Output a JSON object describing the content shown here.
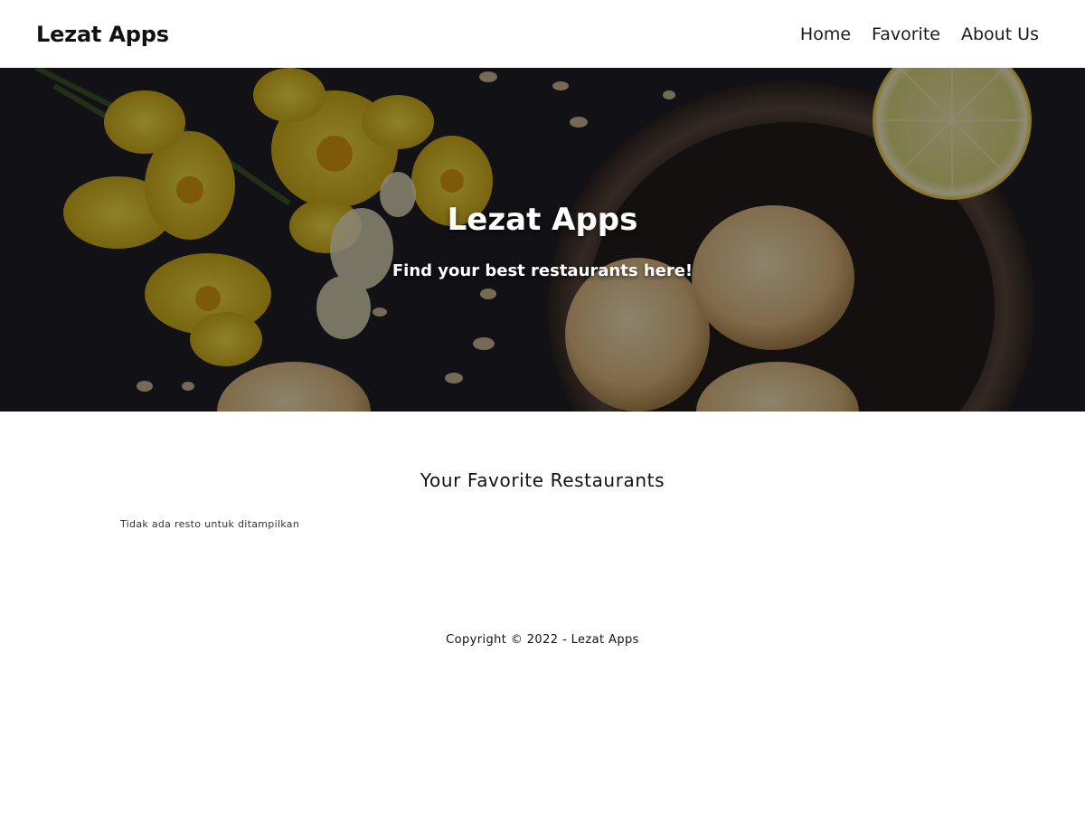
{
  "header": {
    "brand": "Lezat Apps",
    "nav": {
      "home": "Home",
      "favorite": "Favorite",
      "about": "About Us"
    }
  },
  "hero": {
    "title": "Lezat Apps",
    "subtitle": "Find your best restaurants here!",
    "image_icon": "food-photo-cookies-daffodils-lemon"
  },
  "main": {
    "section_title": "Your Favorite Restaurants",
    "empty_message": "Tidak ada resto untuk ditampilkan"
  },
  "footer": {
    "copyright": "Copyright © 2022 - Lezat Apps"
  },
  "colors": {
    "text": "#111111",
    "background": "#ffffff",
    "hero_dark": "#1c1c22",
    "daffodil": "#e8c22a",
    "cookie": "#d9b57a"
  }
}
